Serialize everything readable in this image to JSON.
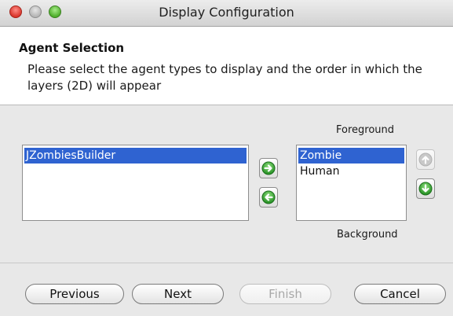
{
  "window": {
    "title": "Display Configuration"
  },
  "header": {
    "heading": "Agent Selection",
    "description": "Please select the agent types to display and the order in which the layers (2D) will appear"
  },
  "available_list": {
    "items": [
      "JZombiesBuilder"
    ],
    "selected": "JZombiesBuilder"
  },
  "display_list": {
    "items": [
      "Zombie",
      "Human"
    ],
    "selected": "Zombie",
    "top_label": "Foreground",
    "bottom_label": "Background"
  },
  "transfer_buttons": {
    "add_icon": "arrow-right-icon",
    "remove_icon": "arrow-left-icon",
    "up_icon": "arrow-up-icon",
    "down_icon": "arrow-down-icon",
    "accent_color": "#2fa22a"
  },
  "footer": {
    "previous_label": "Previous",
    "next_label": "Next",
    "finish_label": "Finish",
    "cancel_label": "Cancel",
    "finish_enabled": false
  }
}
